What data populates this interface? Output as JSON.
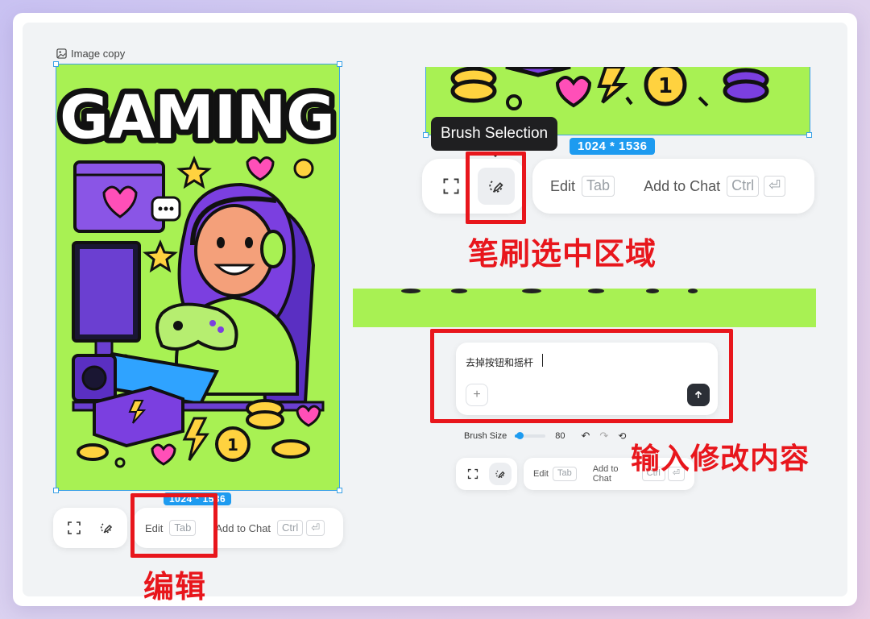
{
  "image": {
    "label": "Image copy",
    "title_art": "GAMING",
    "dimensions": "1024 * 1536"
  },
  "tooltip": {
    "text": "Brush Selection"
  },
  "toolbar": {
    "edit_label": "Edit",
    "edit_key": "Tab",
    "add_label": "Add to Chat",
    "add_key": "Ctrl"
  },
  "chat": {
    "input_value": "去掉按钮和摇杆"
  },
  "brush": {
    "label": "Brush Size",
    "value": "80",
    "level": 0.1
  },
  "annotations": {
    "brush_select": "笔刷选中区域",
    "input_edit": "输入修改内容",
    "edit": "编辑"
  },
  "colors": {
    "accent": "#1d9bf0",
    "annotation": "#e8161c",
    "art_bg": "#a8f153",
    "art_purple": "#6b3fd1"
  }
}
